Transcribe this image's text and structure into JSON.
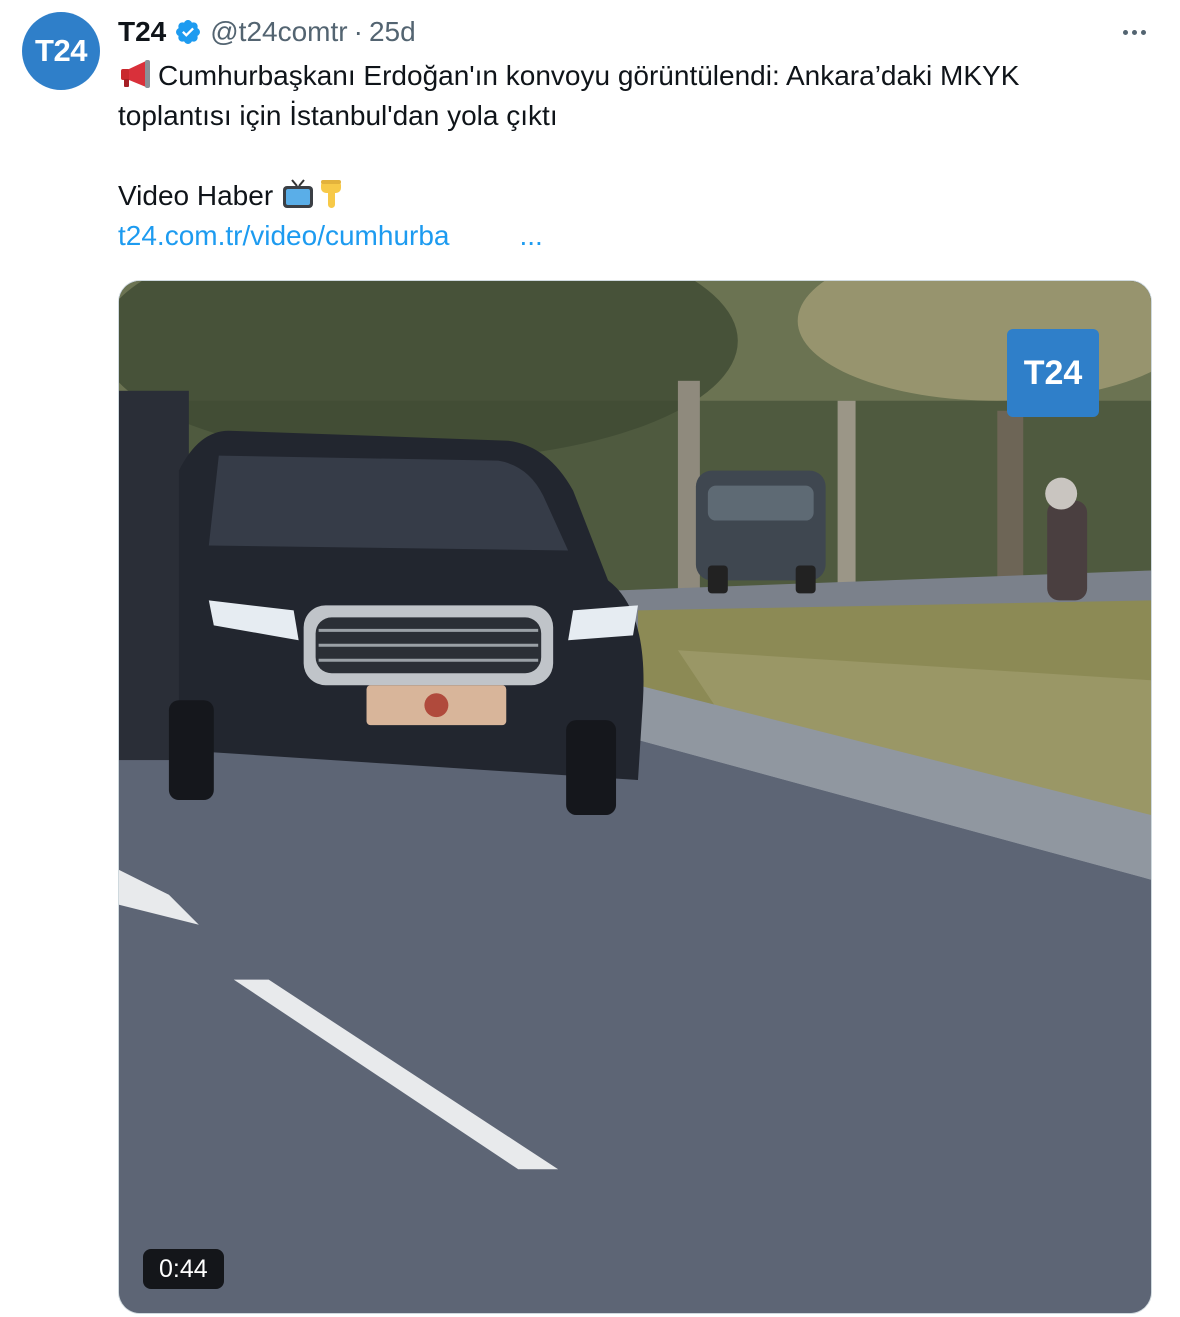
{
  "tweet": {
    "avatar_text": "T24",
    "author_name": "T24",
    "handle": "@t24comtr",
    "separator": "·",
    "time": "25d",
    "text_line1": "Cumhurbaşkanı Erdoğan'ın konvoyu görüntülendi: Ankara’daki MKYK",
    "text_line2": "toplantısı için İstanbul'dan yola çıktı",
    "text_line3": "Video Haber",
    "link_text": "t24.com.tr/video/cumhurba",
    "link_ellipsis": "...",
    "megaphone_icon": "megaphone-icon",
    "tv_icon": "tv-icon",
    "pointing_down_icon": "pointing-down-icon",
    "verified_icon": "verified-badge-icon",
    "more_icon": "more-options-icon"
  },
  "media": {
    "watermark_text": "T24",
    "duration": "0:44"
  },
  "colors": {
    "brand": "#2f7fc9",
    "link": "#1d9bf0",
    "secondary_text": "#536471"
  }
}
